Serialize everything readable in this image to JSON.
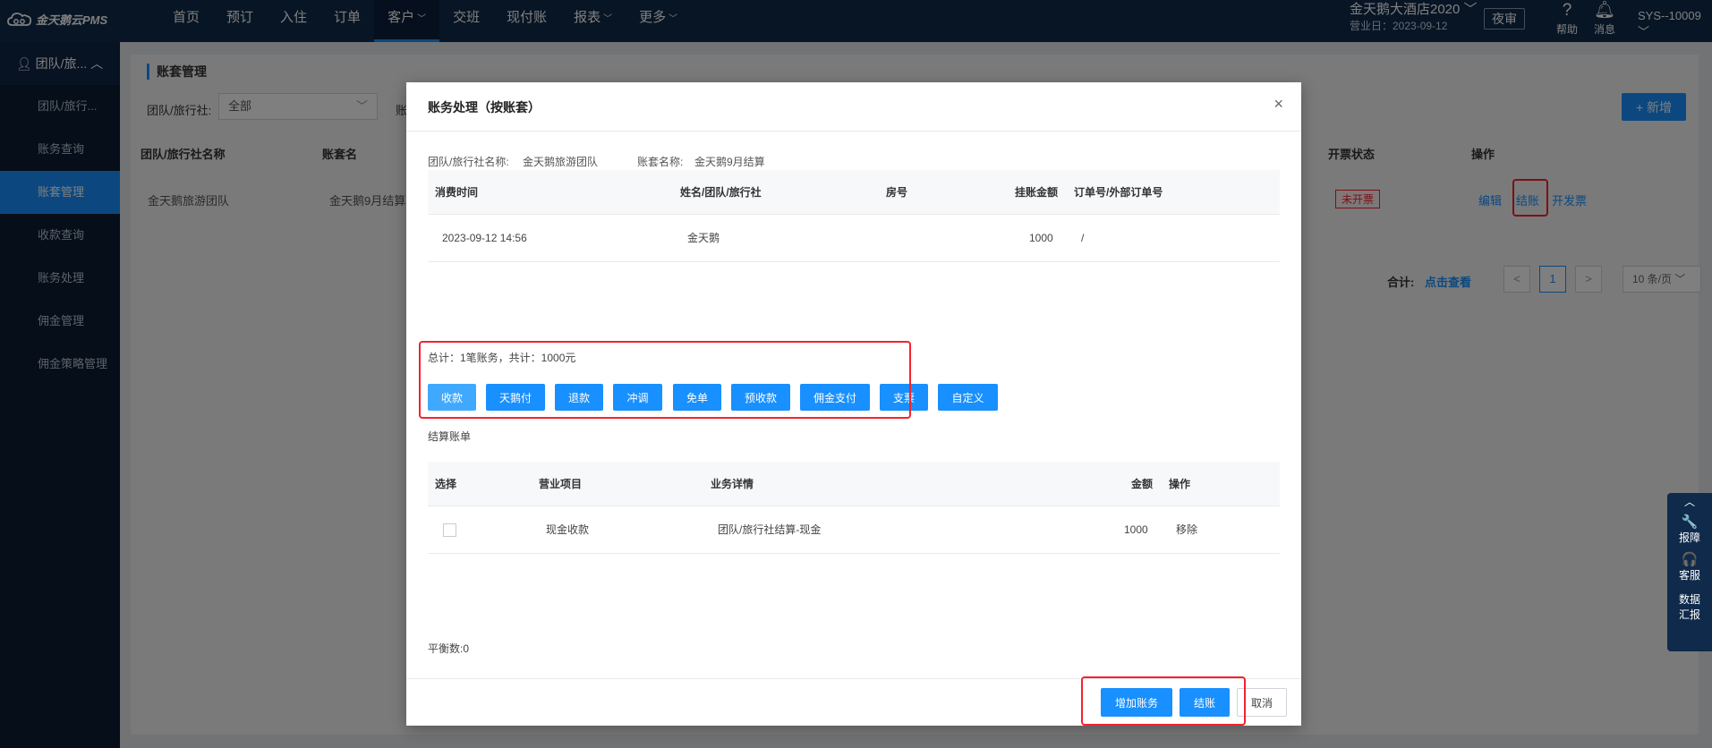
{
  "topbar": {
    "logo": "金天鹅云PMS",
    "nav": [
      {
        "label": "首页",
        "caret": ""
      },
      {
        "label": "预订",
        "caret": ""
      },
      {
        "label": "入住",
        "caret": ""
      },
      {
        "label": "订单",
        "caret": ""
      },
      {
        "label": "客户",
        "caret": "﹀"
      },
      {
        "label": "交班",
        "caret": ""
      },
      {
        "label": "现付账",
        "caret": ""
      },
      {
        "label": "报表",
        "caret": "﹀"
      },
      {
        "label": "更多",
        "caret": "﹀"
      }
    ],
    "hotel_name": "金天鹅大酒店2020 ﹀",
    "business_date": "营业日：2023-09-12",
    "night_audit": "夜审",
    "help": "帮助",
    "messages": "消息",
    "user": "SYS--10009 ﹀"
  },
  "sidebar": {
    "group": "团队/旅...",
    "items": [
      "团队/旅行...",
      "账务查询",
      "账套管理",
      "收款查询",
      "账务处理",
      "佣金管理",
      "佣金策略管理"
    ]
  },
  "background_page": {
    "title": "账套管理",
    "filter_label": "团队/旅行社:",
    "filter_value": "全部",
    "filter_label2": "账",
    "add_button": "+ 新增",
    "headers": {
      "name": "团队/旅行社名称",
      "ledger": "账套名",
      "invoice": "开票状态",
      "ops": "操作"
    },
    "row": {
      "name": "金天鹅旅游团队",
      "ledger": "金天鹅9月结算",
      "invoice": "未开票",
      "edit": "编辑",
      "settle": "结账",
      "invoice_btn": "开发票"
    },
    "summary_label": "合计:",
    "summary_link": "点击查看",
    "page_prev": "<",
    "page_current": "1",
    "page_next": ">",
    "page_size": "10 条/页 ﹀"
  },
  "float_panel": {
    "up": "︿",
    "items": [
      {
        "icon": "🔧",
        "label": "报障"
      },
      {
        "icon": "🎧",
        "label": "客服"
      },
      {
        "icon": "",
        "label": "数据汇报"
      }
    ]
  },
  "modal": {
    "title": "账务处理（按账套）",
    "close": "×",
    "agency_label": "团队/旅行社名称:",
    "agency_value": "金天鹅旅游团队",
    "ledger_label": "账套名称:",
    "ledger_value": "金天鹅9月结算",
    "charges_table": {
      "headers": [
        "消费时间",
        "姓名/团队/旅行社",
        "房号",
        "挂账金额",
        "订单号/外部订单号"
      ],
      "rows": [
        {
          "time": "2023-09-12 14:56",
          "name": "金天鹅",
          "room": "",
          "amount": "1000",
          "order": "/"
        }
      ]
    },
    "total": "总计：1笔账务，共计：1000元",
    "payment_buttons": [
      "收款",
      "天鹅付",
      "退款",
      "冲调",
      "免单",
      "预收款",
      "佣金支付",
      "支票",
      "自定义"
    ],
    "settle_section": "结算账单",
    "settle_table": {
      "headers": [
        "选择",
        "营业项目",
        "业务详情",
        "金额",
        "操作"
      ],
      "rows": [
        {
          "item": "现金收款",
          "detail": "团队/旅行社结算-现金",
          "amount": "1000",
          "action": "移除"
        }
      ]
    },
    "balance": "平衡数:0",
    "footer": {
      "add": "增加账务",
      "settle": "结账",
      "cancel": "取消"
    }
  },
  "colors": {
    "primary": "#1890ff",
    "nav_bg": "#0f2a4a",
    "sidebar_bg": "#0a1c33",
    "annotation": "#f5222d"
  }
}
